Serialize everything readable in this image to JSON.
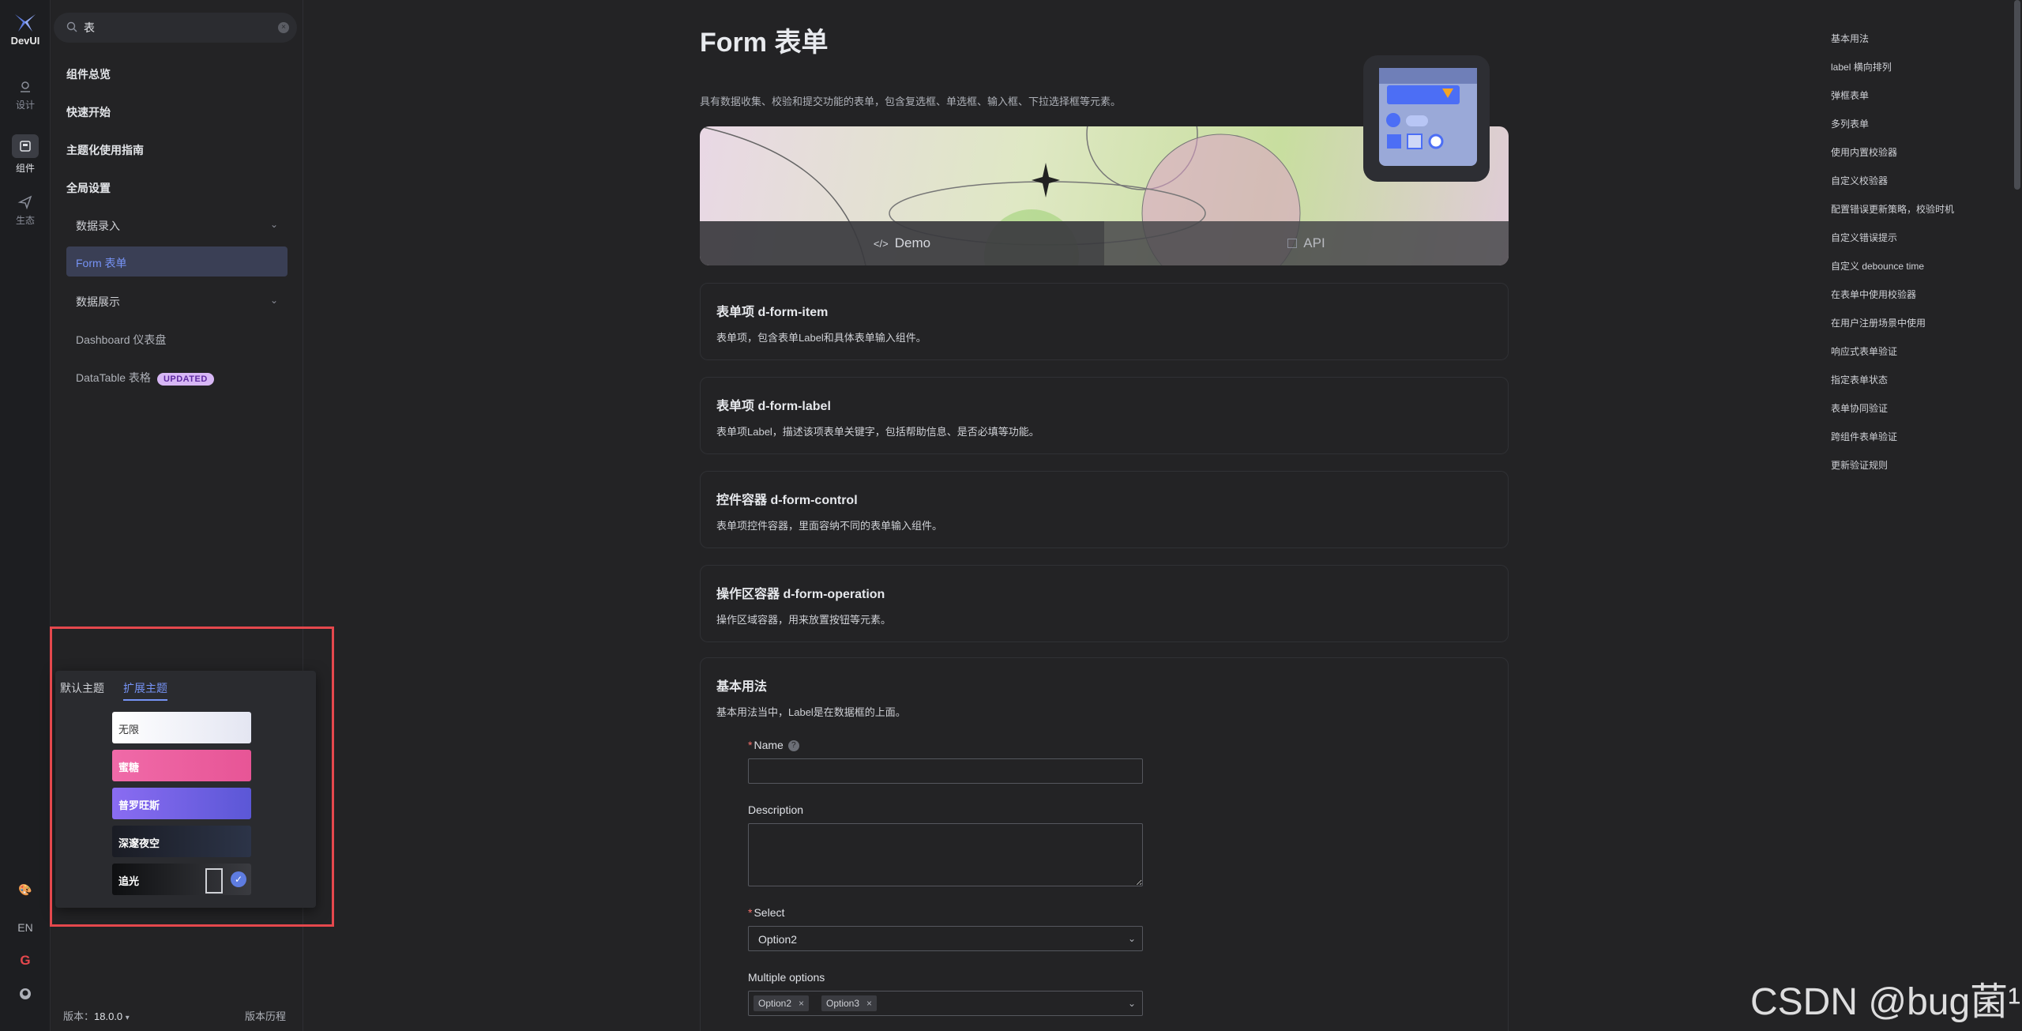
{
  "rail": {
    "logo_text": "DevUI",
    "items": [
      {
        "label": "设计"
      },
      {
        "label": "组件"
      },
      {
        "label": "生态"
      }
    ],
    "lang": "EN"
  },
  "sidebar": {
    "search_value": "表",
    "top_items": [
      "组件总览",
      "快速开始",
      "主题化使用指南",
      "全局设置"
    ],
    "groups": [
      {
        "label": "数据录入"
      },
      {
        "label": "数据展示"
      }
    ],
    "active_item": "Form 表单",
    "sub_items": [
      "Dashboard 仪表盘",
      "DataTable 表格"
    ],
    "badge": "UPDATED",
    "version_label": "版本：",
    "version": "18.0.0",
    "history": "版本历程"
  },
  "theme_popup": {
    "tabs": [
      "默认主题",
      "扩展主题"
    ],
    "active_tab": 1,
    "themes": [
      {
        "label": "无限",
        "bg": "#f1f2f6",
        "fg": "#333333"
      },
      {
        "label": "蜜糖",
        "bg": "#e963a3",
        "fg": "#ffffff"
      },
      {
        "label": "普罗旺斯",
        "bg": "#7a69e0",
        "fg": "#ffffff"
      },
      {
        "label": "深邃夜空",
        "bg": "#1c2233",
        "fg": "#ffffff"
      },
      {
        "label": "追光",
        "bg": "#111214",
        "fg": "#ffffff",
        "selected": true
      }
    ]
  },
  "main": {
    "title": "Form 表单",
    "description": "具有数据收集、校验和提交功能的表单，包含复选框、单选框、输入框、下拉选择框等元素。",
    "tabs": [
      "Demo",
      "API"
    ],
    "cards": [
      {
        "title": "表单项 d-form-item",
        "desc": "表单项，包含表单Label和具体表单输入组件。"
      },
      {
        "title": "表单项 d-form-label",
        "desc": "表单项Label，描述该项表单关键字，包括帮助信息、是否必填等功能。"
      },
      {
        "title": "控件容器 d-form-control",
        "desc": "表单项控件容器，里面容纳不同的表单输入组件。"
      },
      {
        "title": "操作区容器 d-form-operation",
        "desc": "操作区域容器，用来放置按钮等元素。"
      }
    ],
    "demo": {
      "title": "基本用法",
      "intro": "基本用法当中，Label是在数据框的上面。",
      "fields": {
        "name_label": "Name",
        "description_label": "Description",
        "select_label": "Select",
        "select_value": "Option2",
        "multiple_label": "Multiple options",
        "multiple_values": [
          "Option2",
          "Option3"
        ]
      }
    }
  },
  "toc": [
    "基本用法",
    "label 横向排列",
    "弹框表单",
    "多列表单",
    "使用内置校验器",
    "自定义校验器",
    "配置错误更新策略，校验时机",
    "自定义错误提示",
    "自定义 debounce time",
    "在表单中使用校验器",
    "在用户注册场景中使用",
    "响应式表单验证",
    "指定表单状态",
    "表单协同验证",
    "跨组件表单验证",
    "更新验证规则"
  ],
  "watermark": "CSDN @bug菌¹",
  "colors": {
    "accent": "#7693f5",
    "highlight_frame": "#e5484d",
    "badge_bg": "#d7b7f5"
  }
}
